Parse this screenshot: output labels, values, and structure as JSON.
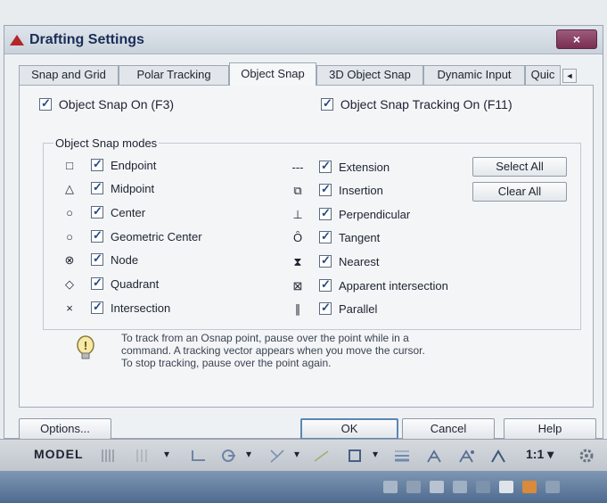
{
  "window": {
    "title": "Drafting Settings",
    "close_glyph": "×"
  },
  "tabs": [
    {
      "label": "Snap and Grid",
      "active": false
    },
    {
      "label": "Polar Tracking",
      "active": false
    },
    {
      "label": "Object Snap",
      "active": true
    },
    {
      "label": "3D Object Snap",
      "active": false
    },
    {
      "label": "Dynamic Input",
      "active": false
    },
    {
      "label": "Quic",
      "active": false
    }
  ],
  "tab_scroll": {
    "left": "◄",
    "right": "►"
  },
  "options": {
    "object_snap_on": {
      "label": "Object Snap On (F3)",
      "checked": true
    },
    "object_snap_tracking_on": {
      "label": "Object Snap Tracking On (F11)",
      "checked": true
    }
  },
  "modes": {
    "legend": "Object Snap modes",
    "left": [
      {
        "label": "Endpoint",
        "checked": true,
        "icon": "square-icon",
        "glyph": "□"
      },
      {
        "label": "Midpoint",
        "checked": true,
        "icon": "triangle-icon",
        "glyph": "△"
      },
      {
        "label": "Center",
        "checked": true,
        "icon": "circle-icon",
        "glyph": "○"
      },
      {
        "label": "Geometric Center",
        "checked": true,
        "icon": "circle-icon",
        "glyph": "○"
      },
      {
        "label": "Node",
        "checked": true,
        "icon": "node-icon",
        "glyph": "⊗"
      },
      {
        "label": "Quadrant",
        "checked": true,
        "icon": "diamond-icon",
        "glyph": "◇"
      },
      {
        "label": "Intersection",
        "checked": true,
        "icon": "x-icon",
        "glyph": "×"
      }
    ],
    "right": [
      {
        "label": "Extension",
        "checked": true,
        "icon": "extension-icon",
        "glyph": "---"
      },
      {
        "label": "Insertion",
        "checked": true,
        "icon": "insertion-icon",
        "glyph": "⧉"
      },
      {
        "label": "Perpendicular",
        "checked": true,
        "icon": "perpendicular-icon",
        "glyph": "⊥"
      },
      {
        "label": "Tangent",
        "checked": true,
        "icon": "tangent-icon",
        "glyph": "Ȏ"
      },
      {
        "label": "Nearest",
        "checked": true,
        "icon": "hourglass-icon",
        "glyph": "⧗"
      },
      {
        "label": "Apparent intersection",
        "checked": true,
        "icon": "boxed-x-icon",
        "glyph": "⊠"
      },
      {
        "label": "Parallel",
        "checked": true,
        "icon": "parallel-icon",
        "glyph": "∥"
      }
    ]
  },
  "buttons": {
    "select_all": "Select All",
    "clear_all": "Clear All",
    "options": "Options...",
    "ok": "OK",
    "cancel": "Cancel",
    "help": "Help"
  },
  "tip": {
    "icon": "lightbulb-icon",
    "lines": [
      "To track from an Osnap point, pause over the point while in a",
      "command.  A tracking vector appears when you move the cursor.",
      "To stop tracking, pause over the point again."
    ]
  },
  "statusbar": {
    "model": "MODEL",
    "scale": "1:1 ▾"
  },
  "colors": {
    "accent": "#234b87",
    "title_text": "#1b2d57",
    "close": "#7a2e51",
    "taskbar": "#5a7599"
  }
}
